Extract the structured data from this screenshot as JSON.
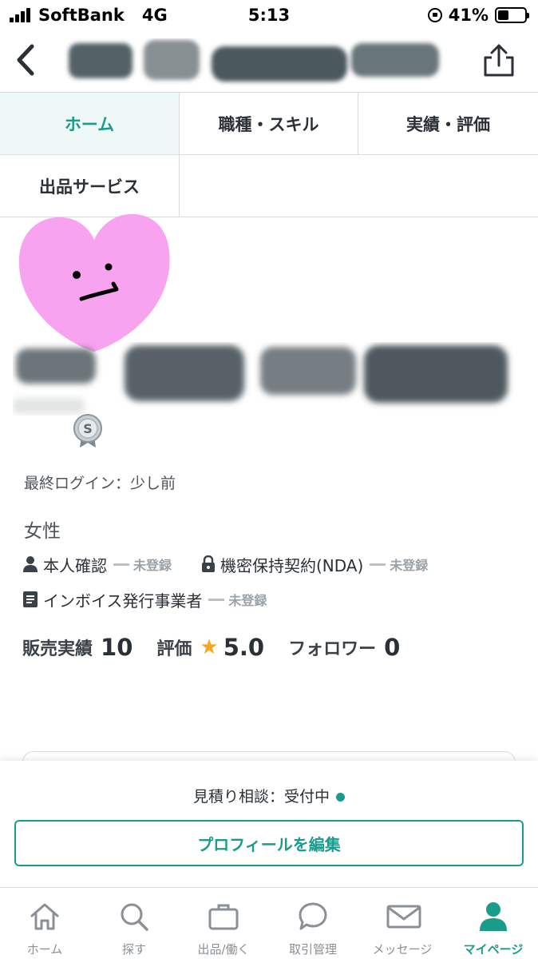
{
  "status_bar": {
    "carrier": "SoftBank",
    "network": "4G",
    "time": "5:13",
    "battery": "41%",
    "battery_level": 0.41
  },
  "tabs": [
    {
      "label": "ホーム",
      "active": true
    },
    {
      "label": "職種・スキル",
      "active": false
    },
    {
      "label": "実績・評価",
      "active": false
    },
    {
      "label": "出品サービス",
      "active": false
    }
  ],
  "profile": {
    "last_login": "最終ログイン：少し前",
    "gender": "女性",
    "verifications": [
      {
        "label": "本人確認",
        "status": "未登録",
        "icon": "person-icon"
      },
      {
        "label": "機密保持契約(NDA)",
        "status": "未登録",
        "icon": "lock-icon"
      },
      {
        "label": "インボイス発行事業者",
        "status": "未登録",
        "icon": "document-icon"
      }
    ],
    "stats": {
      "sales_label": "販売実績",
      "sales_value": "10",
      "rating_label": "評価",
      "rating_value": "5.0",
      "followers_label": "フォロワー",
      "followers_value": "0"
    }
  },
  "action": {
    "quote_status": "見積り相談：受付中",
    "edit_button": "プロフィールを編集"
  },
  "tabbar": [
    {
      "label": "ホーム",
      "icon": "home-icon",
      "active": false
    },
    {
      "label": "探す",
      "icon": "search-icon",
      "active": false
    },
    {
      "label": "出品/働く",
      "icon": "briefcase-icon",
      "active": false
    },
    {
      "label": "取引管理",
      "icon": "chat-bubble-icon",
      "active": false
    },
    {
      "label": "メッセージ",
      "icon": "mail-icon",
      "active": false
    },
    {
      "label": "マイページ",
      "icon": "person-icon",
      "active": true
    }
  ],
  "colors": {
    "accent": "#1a9c8c",
    "active_tab_bg": "#eef8f6",
    "star": "#f5a623",
    "muted": "#9aa2a8"
  }
}
